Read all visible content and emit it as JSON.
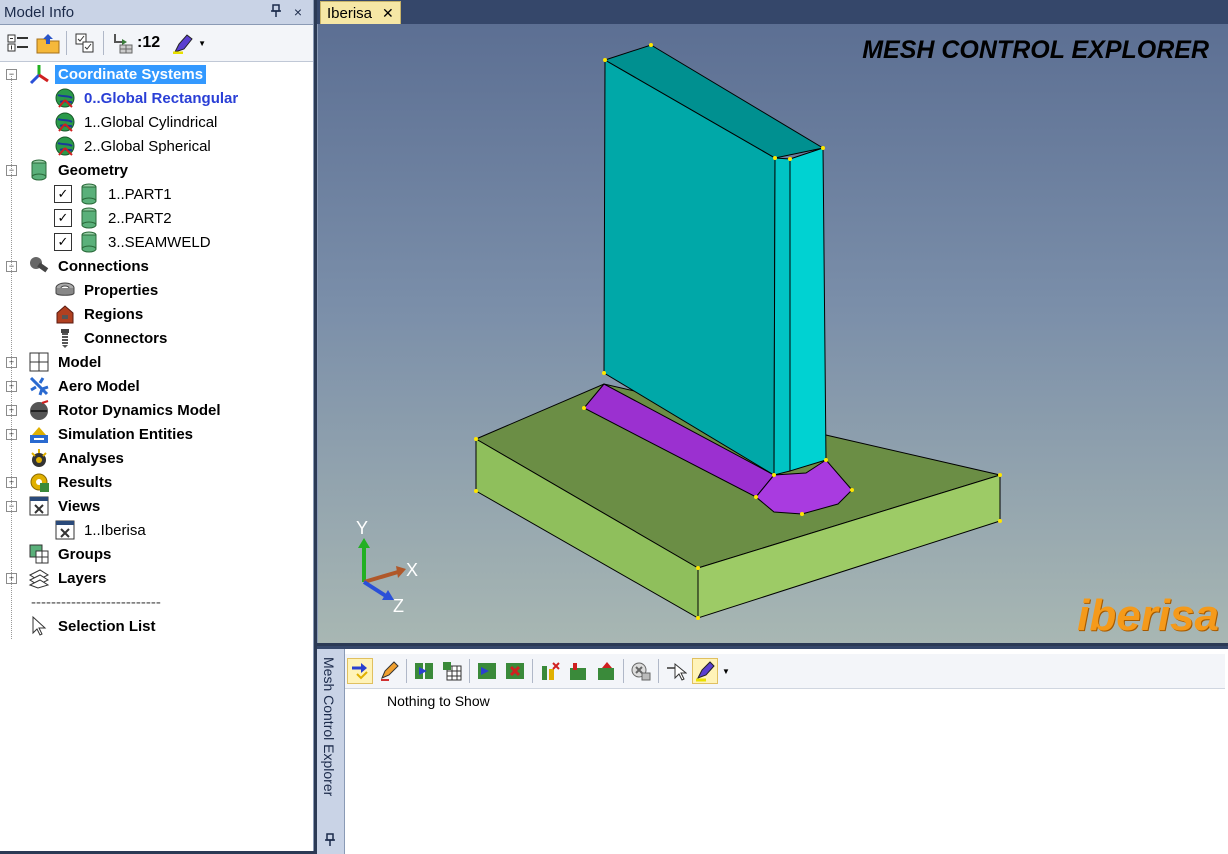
{
  "panel": {
    "title": "Model Info",
    "pin": "📌",
    "close": "×"
  },
  "toolbar": {
    "count_label": ":12"
  },
  "tree": [
    {
      "id": "coordinate-systems",
      "label": "Coordinate Systems",
      "bold": true,
      "selected": true,
      "toggle": "−",
      "level": 0,
      "icon": "axes-icon"
    },
    {
      "id": "global-rectangular",
      "label": "0..Global Rectangular",
      "highlight": true,
      "level": 1,
      "icon": "globe-axes-icon"
    },
    {
      "id": "global-cylindrical",
      "label": "1..Global Cylindrical",
      "level": 1,
      "icon": "globe-axes-icon"
    },
    {
      "id": "global-spherical",
      "label": "2..Global Spherical",
      "level": 1,
      "icon": "globe-axes-icon"
    },
    {
      "id": "geometry",
      "label": "Geometry",
      "bold": true,
      "toggle": "−",
      "level": 0,
      "icon": "cylinder-icon"
    },
    {
      "id": "part1",
      "label": "1..PART1",
      "level": 1,
      "check": true,
      "icon": "cylinder-icon"
    },
    {
      "id": "part2",
      "label": "2..PART2",
      "level": 1,
      "check": true,
      "icon": "cylinder-icon"
    },
    {
      "id": "seamweld",
      "label": "3..SEAMWELD",
      "level": 1,
      "check": true,
      "icon": "cylinder-icon"
    },
    {
      "id": "connections",
      "label": "Connections",
      "bold": true,
      "toggle": "−",
      "level": 0,
      "icon": "connector-icon"
    },
    {
      "id": "properties",
      "label": "Properties",
      "bold": true,
      "level": 1,
      "icon": "nut-icon"
    },
    {
      "id": "regions",
      "label": "Regions",
      "bold": true,
      "level": 1,
      "icon": "region-icon"
    },
    {
      "id": "connectors",
      "label": "Connectors",
      "bold": true,
      "level": 1,
      "icon": "bolt-icon"
    },
    {
      "id": "model",
      "label": "Model",
      "bold": true,
      "toggle": "+",
      "level": 0,
      "icon": "grid-icon"
    },
    {
      "id": "aero-model",
      "label": "Aero Model",
      "bold": true,
      "toggle": "+",
      "level": 0,
      "icon": "plane-icon"
    },
    {
      "id": "rotor-dynamics",
      "label": "Rotor Dynamics Model",
      "bold": true,
      "toggle": "+",
      "level": 0,
      "icon": "rotor-icon"
    },
    {
      "id": "simulation-entities",
      "label": "Simulation Entities",
      "bold": true,
      "toggle": "+",
      "level": 0,
      "icon": "simulation-icon"
    },
    {
      "id": "analyses",
      "label": "Analyses",
      "bold": true,
      "level": 0,
      "icon": "analysis-icon"
    },
    {
      "id": "results",
      "label": "Results",
      "bold": true,
      "toggle": "+",
      "level": 0,
      "icon": "results-icon"
    },
    {
      "id": "views",
      "label": "Views",
      "bold": true,
      "toggle": "−",
      "level": 0,
      "icon": "view-icon"
    },
    {
      "id": "iberisa-view",
      "label": "1..Iberisa",
      "level": 1,
      "icon": "view-icon"
    },
    {
      "id": "groups",
      "label": "Groups",
      "bold": true,
      "level": 0,
      "icon": "groups-icon"
    },
    {
      "id": "layers",
      "label": "Layers",
      "bold": true,
      "toggle": "+",
      "level": 0,
      "icon": "layers-icon"
    },
    {
      "id": "separator",
      "label": "--------------------------",
      "level": 0,
      "dash": true
    },
    {
      "id": "selection-list",
      "label": "Selection List",
      "bold": true,
      "level": 0,
      "icon": "cursor-icon"
    }
  ],
  "viewport": {
    "tab_label": "Iberisa",
    "tab_close": "✕",
    "overlay_title": "MESH CONTROL EXPLORER",
    "brand": "iberisa",
    "axis_labels": {
      "y": "Y",
      "x": "X",
      "z": "Z"
    },
    "colors": {
      "plate_top": "#6b8e45",
      "plate_front": "#9dcb66",
      "plate_side": "#8fbf5c",
      "fin_front": "#00a8a8",
      "fin_top": "#009090",
      "fin_side": "#00cccc",
      "weld": "#9b30d0",
      "background_top": "#5c6f93",
      "background_bottom": "#a8b7b3"
    }
  },
  "explorer": {
    "title": "Mesh Control Explorer",
    "pin": "📌",
    "empty_text": "Nothing to Show"
  },
  "colors": {
    "selection": "#3399ff",
    "panel_title": "#c9d3e6",
    "highlight_text": "#2a3fd6",
    "brand": "#f59a1a"
  }
}
